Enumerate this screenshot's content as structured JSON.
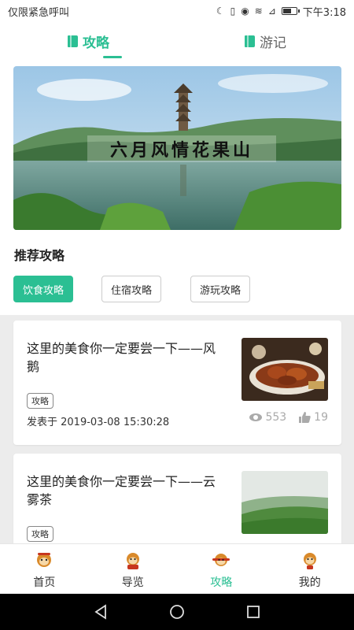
{
  "status_bar": {
    "carrier": "仅限紧急呼叫",
    "time": "下午3:18"
  },
  "top_tabs": [
    {
      "label": "攻略",
      "active": true
    },
    {
      "label": "游记",
      "active": false
    }
  ],
  "banner": {
    "title": "六月风情花果山"
  },
  "section": {
    "title": "推荐攻略"
  },
  "filters": [
    {
      "label": "饮食攻略",
      "active": true
    },
    {
      "label": "住宿攻略",
      "active": false
    },
    {
      "label": "游玩攻略",
      "active": false
    }
  ],
  "articles": [
    {
      "title": "这里的美食你一定要尝一下——风鹅",
      "tag": "攻略",
      "date": "发表于 2019-03-08 15:30:28",
      "views": "553",
      "likes": "19"
    },
    {
      "title": "这里的美食你一定要尝一下——云雾茶",
      "tag": "攻略"
    }
  ],
  "bottom_nav": [
    {
      "label": "首页",
      "active": false
    },
    {
      "label": "导览",
      "active": false
    },
    {
      "label": "攻略",
      "active": true
    },
    {
      "label": "我的",
      "active": false
    }
  ],
  "colors": {
    "accent": "#2bbf93",
    "background": "#ececec"
  }
}
